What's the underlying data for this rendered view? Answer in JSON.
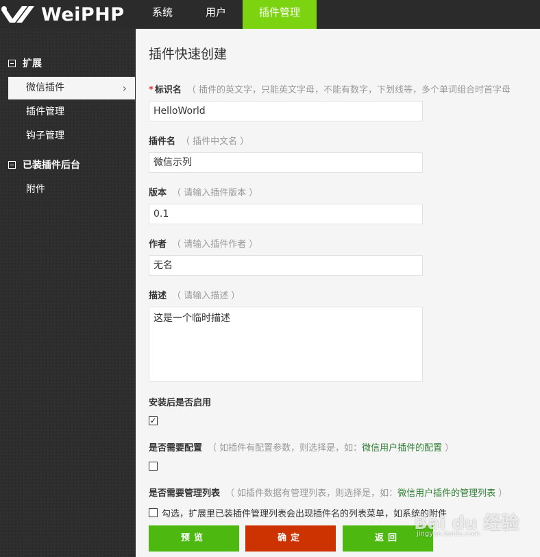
{
  "header": {
    "brand": "WeiPHP",
    "nav": [
      "系统",
      "用户",
      "插件管理"
    ]
  },
  "sidebar": {
    "groups": [
      {
        "label": "扩展",
        "items": [
          "微信插件",
          "插件管理",
          "钩子管理"
        ]
      },
      {
        "label": "已装插件后台",
        "items": [
          "附件"
        ]
      }
    ]
  },
  "form": {
    "title": "插件快速创建",
    "identifier": {
      "label": "标识名",
      "hint": "（ 插件的英文字，只能英文字母，不能有数字，下划线等，多个单词组合时首字母",
      "value": "HelloWorld"
    },
    "plugin_name": {
      "label": "插件名",
      "hint": "（ 插件中文名 ）",
      "value": "微信示列"
    },
    "version": {
      "label": "版本",
      "hint": "（ 请输入插件版本 ）",
      "value": "0.1"
    },
    "author": {
      "label": "作者",
      "hint": "（ 请输入插件作者 ）",
      "value": "无名"
    },
    "description": {
      "label": "描述",
      "hint": "（ 请输入描述 ）",
      "value": "这是一个临时描述"
    },
    "enable": {
      "label": "安装后是否启用",
      "checked": true
    },
    "config": {
      "label": "是否需要配置",
      "hint_pre": "（ 如插件有配置参数，则选择是，如：",
      "hint_link": "微信用户插件的配置",
      "hint_post": " ）",
      "checked": false
    },
    "admin_list": {
      "label": "是否需要管理列表",
      "hint_pre": "（ 如插件数据有管理列表，则选择是，如：",
      "hint_link": "微信用户插件的管理列表",
      "hint_post": " ）",
      "checked": false,
      "option_text": "勾选，扩展里已装插件管理列表会出现插件名的列表菜单，如系统的附件"
    },
    "buttons": {
      "preview": "预览",
      "confirm": "确定",
      "back": "返回"
    },
    "check_mark": "✓"
  },
  "watermark": {
    "main": "Bai du 经验",
    "sub": "jingyan.baidu.com"
  }
}
